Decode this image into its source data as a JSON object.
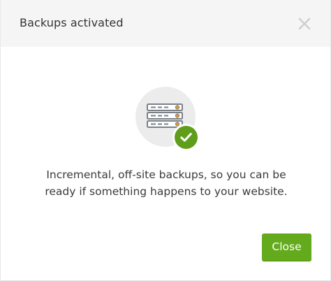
{
  "dialog": {
    "title": "Backups activated",
    "close_icon": "close-icon",
    "illustration": {
      "icon": "server-rack-icon",
      "badge_icon": "checkmark-icon",
      "badge_color": "#5e9e1a"
    },
    "message": "Incremental, off-site backups, so you can be ready if something happens to your website.",
    "close_button_label": "Close",
    "accent_color": "#64aa1d"
  }
}
